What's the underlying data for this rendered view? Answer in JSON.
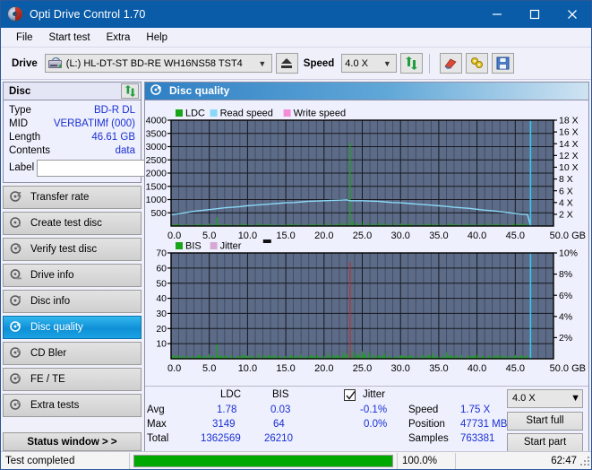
{
  "window": {
    "title": "Opti Drive Control 1.70",
    "icon": "disc-icon",
    "minimize": "–",
    "maximize": "□",
    "close": "✕"
  },
  "menu": {
    "items": [
      "File",
      "Start test",
      "Extra",
      "Help"
    ]
  },
  "toolbar": {
    "drive_label": "Drive",
    "drive_value": "(L:)  HL-DT-ST BD-RE  WH16NS58 TST4",
    "eject_icon": "eject-icon",
    "speed_label": "Speed",
    "speed_value": "4.0 X",
    "refresh_icon": "refresh-icon",
    "eraser_icon": "eraser-icon",
    "tools_icon": "tools-icon",
    "save_icon": "save-icon"
  },
  "sidebar": {
    "disc_panel": {
      "title": "Disc",
      "refresh_icon": "refresh-icon",
      "rows": [
        {
          "key": "Type",
          "value": "BD-R DL"
        },
        {
          "key": "MID",
          "value": "VERBATIMf (000)"
        },
        {
          "key": "Length",
          "value": "46.61 GB"
        },
        {
          "key": "Contents",
          "value": "data"
        }
      ],
      "label_key": "Label",
      "label_value": "",
      "label_placeholder": "",
      "label_button_icon": "cd-icon"
    },
    "nav": [
      {
        "label": "Transfer rate",
        "icon": "disc-transfer-icon",
        "active": false
      },
      {
        "label": "Create test disc",
        "icon": "disc-create-icon",
        "active": false
      },
      {
        "label": "Verify test disc",
        "icon": "disc-verify-icon",
        "active": false
      },
      {
        "label": "Drive info",
        "icon": "drive-info-icon",
        "active": false
      },
      {
        "label": "Disc info",
        "icon": "disc-info-icon",
        "active": false
      },
      {
        "label": "Disc quality",
        "icon": "disc-quality-icon",
        "active": true
      },
      {
        "label": "CD Bler",
        "icon": "cd-bler-icon",
        "active": false
      },
      {
        "label": "FE / TE",
        "icon": "fe-te-icon",
        "active": false
      },
      {
        "label": "Extra tests",
        "icon": "extra-tests-icon",
        "active": false
      }
    ],
    "status_window_button": "Status window > >"
  },
  "main": {
    "title": "Disc quality",
    "title_icon": "disc-quality-icon"
  },
  "stats": {
    "col_headers": [
      "LDC",
      "BIS"
    ],
    "rows": [
      {
        "label": "Avg",
        "ldc": "1.78",
        "bis": "0.03",
        "jitter": "-0.1%"
      },
      {
        "label": "Max",
        "ldc": "3149",
        "bis": "64",
        "jitter": "0.0%"
      },
      {
        "label": "Total",
        "ldc": "1362569",
        "bis": "26210",
        "jitter": ""
      }
    ],
    "jitter_label": "Jitter",
    "jitter_checked": true,
    "speed_label": "Speed",
    "speed_value": "1.75 X",
    "position_label": "Position",
    "position_value": "47731 MB",
    "samples_label": "Samples",
    "samples_value": "763381",
    "speed_select": "4.0 X",
    "start_full_button": "Start full",
    "start_part_button": "Start part"
  },
  "statusbar": {
    "message": "Test completed",
    "percent_text": "100.0%",
    "percent_value": 100,
    "elapsed": "62:47"
  },
  "colors": {
    "accent": "#0a5ca8",
    "plot_bg": "#5c6b87",
    "grid": "#2a2f3e",
    "ldc_green": "#18a618",
    "read_speed": "#89d8f7",
    "write_speed": "#f58cd8",
    "bis_green": "#18a618",
    "jitter_pink": "#d6a8d6",
    "value_blue": "#1a2fd4",
    "progress_green": "#00a800",
    "marker_cyan": "#36c8f0",
    "spike_red": "#c03030"
  },
  "chart_data": [
    {
      "type": "line",
      "name": "disc-quality-top-chart",
      "title": "",
      "xlabel": "GB",
      "ylabel": "",
      "xlim": [
        0.0,
        50.0
      ],
      "xticks": [
        0.0,
        5.0,
        10.0,
        15.0,
        20.0,
        25.0,
        30.0,
        35.0,
        40.0,
        45.0,
        50.0
      ],
      "xticklabels": [
        "0.0",
        "5.0",
        "10.0",
        "15.0",
        "20.0",
        "25.0",
        "30.0",
        "35.0",
        "40.0",
        "45.0",
        "50.0 GB"
      ],
      "ylim": [
        0,
        4000
      ],
      "yticks": [
        500,
        1000,
        1500,
        2000,
        2500,
        3000,
        3500,
        4000
      ],
      "yticklabels": [
        "500",
        "1000",
        "1500",
        "2000",
        "2500",
        "3000",
        "3500",
        "4000"
      ],
      "y2lim": [
        0,
        18
      ],
      "y2ticks": [
        2,
        4,
        6,
        8,
        10,
        12,
        14,
        16,
        18
      ],
      "y2ticklabels": [
        "2 X",
        "4 X",
        "6 X",
        "8 X",
        "10 X",
        "12 X",
        "14 X",
        "16 X",
        "18 X"
      ],
      "grid": true,
      "legend": [
        "LDC",
        "Read speed",
        "Write speed"
      ],
      "legend_position": "top-left",
      "series": [
        {
          "name": "Read speed",
          "axis": "y2",
          "color": "#89d8f7",
          "x": [
            0.0,
            1.0,
            2.0,
            3.0,
            4.0,
            5.0,
            6.0,
            7.0,
            8.0,
            9.0,
            10.0,
            11.0,
            12.0,
            13.0,
            14.0,
            15.0,
            16.0,
            17.0,
            18.0,
            19.0,
            20.0,
            21.0,
            22.0,
            23.0,
            23.4,
            24.0,
            25.0,
            26.0,
            27.0,
            28.0,
            29.0,
            30.0,
            31.0,
            32.0,
            33.0,
            34.0,
            35.0,
            36.0,
            37.0,
            38.0,
            39.0,
            40.0,
            41.0,
            42.0,
            43.0,
            44.0,
            45.0,
            46.0,
            46.6,
            47.0
          ],
          "y": [
            1.9,
            2.1,
            2.3,
            2.5,
            2.65,
            2.8,
            2.95,
            3.1,
            3.2,
            3.3,
            3.45,
            3.55,
            3.65,
            3.75,
            3.85,
            3.95,
            4.0,
            4.1,
            4.2,
            4.25,
            4.3,
            4.35,
            4.4,
            4.45,
            4.3,
            4.3,
            4.3,
            4.25,
            4.2,
            4.1,
            4.0,
            3.95,
            3.85,
            3.75,
            3.65,
            3.55,
            3.45,
            3.35,
            3.2,
            3.1,
            3.0,
            2.85,
            2.7,
            2.6,
            2.45,
            2.3,
            2.15,
            2.0,
            1.95,
            0.0
          ]
        },
        {
          "name": "LDC",
          "axis": "y1",
          "color": "#18a618",
          "type": "impulse",
          "x": [
            0.3,
            0.8,
            1.4,
            2.1,
            2.9,
            3.6,
            4.2,
            5.0,
            5.6,
            6.0,
            6.4,
            7.1,
            7.8,
            8.5,
            9.2,
            9.9,
            10.6,
            11.3,
            11.9,
            12.5,
            13.2,
            13.9,
            14.6,
            15.3,
            16.0,
            16.7,
            17.4,
            18.1,
            18.8,
            19.5,
            20.2,
            20.9,
            21.6,
            22.3,
            22.9,
            23.4,
            23.8,
            24.4,
            25.1,
            25.8,
            26.5,
            27.2,
            27.9,
            28.6,
            29.3,
            30.0,
            30.7,
            31.4,
            32.1,
            32.8,
            33.5,
            34.2,
            34.9,
            35.6,
            36.3,
            37.0,
            37.7,
            38.4,
            39.1,
            39.8,
            40.5,
            41.2,
            41.9,
            42.6,
            43.3,
            44.0,
            44.7,
            45.4,
            46.1,
            46.6
          ],
          "y": [
            60,
            70,
            55,
            80,
            65,
            75,
            60,
            90,
            70,
            330,
            85,
            60,
            75,
            55,
            95,
            70,
            60,
            110,
            75,
            65,
            90,
            70,
            55,
            80,
            60,
            95,
            70,
            85,
            60,
            75,
            120,
            90,
            70,
            150,
            110,
            3149,
            190,
            130,
            160,
            110,
            90,
            140,
            100,
            80,
            120,
            95,
            70,
            110,
            85,
            60,
            100,
            75,
            90,
            65,
            110,
            80,
            70,
            95,
            60,
            85,
            75,
            120,
            90,
            70,
            100,
            80,
            95,
            70,
            110,
            60
          ]
        }
      ],
      "markers": [
        {
          "name": "position-marker",
          "x": 47.0,
          "color": "#36c8f0"
        }
      ]
    },
    {
      "type": "line",
      "name": "disc-quality-bottom-chart",
      "title": "",
      "xlabel": "GB",
      "ylabel": "",
      "xlim": [
        0.0,
        50.0
      ],
      "xticks": [
        0.0,
        5.0,
        10.0,
        15.0,
        20.0,
        25.0,
        30.0,
        35.0,
        40.0,
        45.0,
        50.0
      ],
      "xticklabels": [
        "0.0",
        "5.0",
        "10.0",
        "15.0",
        "20.0",
        "25.0",
        "30.0",
        "35.0",
        "40.0",
        "45.0",
        "50.0 GB"
      ],
      "ylim": [
        0,
        70
      ],
      "yticks": [
        10,
        20,
        30,
        40,
        50,
        60,
        70
      ],
      "yticklabels": [
        "10",
        "20",
        "30",
        "40",
        "50",
        "60",
        "70"
      ],
      "y2lim": [
        0,
        10
      ],
      "y2ticks": [
        2,
        4,
        6,
        8,
        10
      ],
      "y2ticklabels": [
        "2%",
        "4%",
        "6%",
        "8%",
        "10%"
      ],
      "grid": true,
      "legend": [
        "BIS",
        "Jitter"
      ],
      "legend_position": "top-left",
      "series": [
        {
          "name": "BIS",
          "axis": "y1",
          "color": "#18a618",
          "type": "impulse",
          "x": [
            0.3,
            0.9,
            1.5,
            2.2,
            2.9,
            3.6,
            4.3,
            5.0,
            5.5,
            6.0,
            6.5,
            7.2,
            7.9,
            8.6,
            9.3,
            10.0,
            10.7,
            11.4,
            12.1,
            12.8,
            13.5,
            14.2,
            14.9,
            15.6,
            16.3,
            17.0,
            17.7,
            18.4,
            19.1,
            19.8,
            20.5,
            21.2,
            21.9,
            22.6,
            23.0,
            23.4,
            23.9,
            24.5,
            25.0,
            25.4,
            25.9,
            26.5,
            27.2,
            27.9,
            28.6,
            29.3,
            30.0,
            30.7,
            31.4,
            32.1,
            32.8,
            33.5,
            34.2,
            34.9,
            35.6,
            36.0,
            36.6,
            37.3,
            38.0,
            38.7,
            39.4,
            40.1,
            40.8,
            41.5,
            42.2,
            42.9,
            43.6,
            44.3,
            45.0,
            45.7,
            46.4,
            46.6
          ],
          "y": [
            2.5,
            2.0,
            1.8,
            2.2,
            1.9,
            2.6,
            1.7,
            3.0,
            2.1,
            9.8,
            2.3,
            1.8,
            2.5,
            1.6,
            2.9,
            2.0,
            1.7,
            3.2,
            2.2,
            1.9,
            2.7,
            2.1,
            1.6,
            2.4,
            1.8,
            2.9,
            2.0,
            2.6,
            1.7,
            2.2,
            3.5,
            2.7,
            2.1,
            4.2,
            3.0,
            8.0,
            4.5,
            3.6,
            5.0,
            3.2,
            4.0,
            2.8,
            2.2,
            3.4,
            2.0,
            1.7,
            2.4,
            1.9,
            2.2,
            1.6,
            2.8,
            2.0,
            3.6,
            1.8,
            2.2,
            4.2,
            2.0,
            1.7,
            2.4,
            1.9,
            2.1,
            3.0,
            1.8,
            2.2,
            1.6,
            2.5,
            1.9,
            2.1,
            2.4,
            1.8,
            2.0,
            1.7
          ]
        },
        {
          "name": "Jitter",
          "axis": "y2",
          "color": "#d6a8d6",
          "x": [],
          "y": []
        }
      ],
      "markers": [
        {
          "name": "max-bis-marker",
          "x": 23.4,
          "y": 64,
          "color": "#c03030"
        },
        {
          "name": "position-marker",
          "x": 47.0,
          "color": "#36c8f0"
        }
      ]
    }
  ]
}
